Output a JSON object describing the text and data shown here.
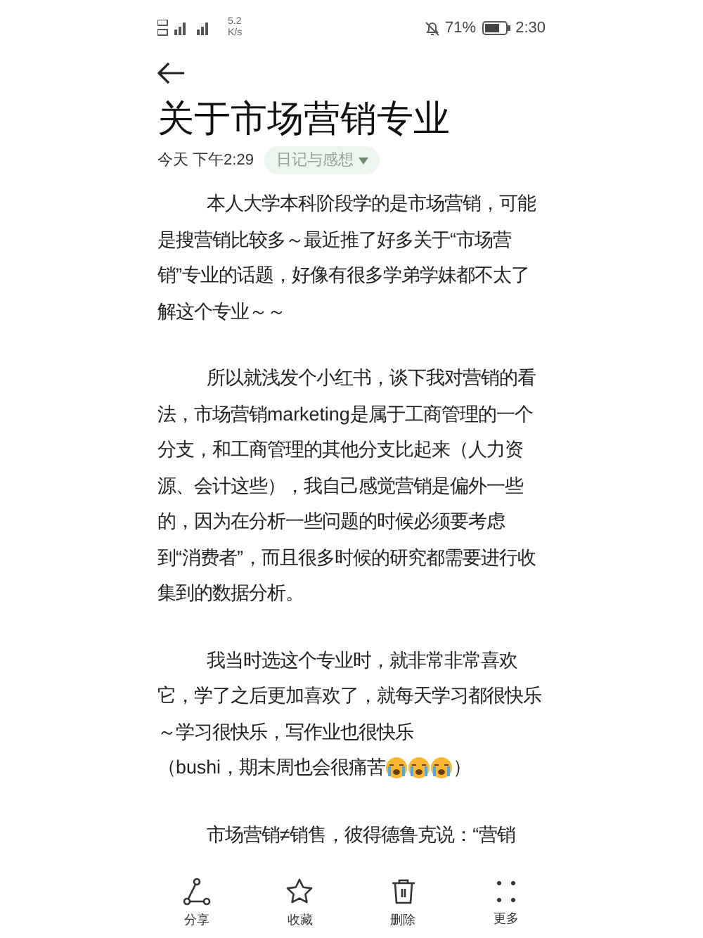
{
  "status_bar": {
    "network_speed": "5.2",
    "speed_unit": "K/s",
    "battery": "71%",
    "time": "2:30"
  },
  "title": "关于市场营销专业",
  "meta": {
    "date": "今天 下午2:29",
    "category": "日记与感想"
  },
  "paragraphs": [
    {
      "segments": [
        {
          "kind": "text",
          "text": "本人大学本科阶段学的是市场营销，可能是搜营销比较多～最近推了好多关于“市场营销”专业的话题，好像有很多学弟学妹都不太了解这个专业～～"
        }
      ]
    },
    {
      "segments": [
        {
          "kind": "text",
          "text": "所以就浅发个小红书，谈下我对营销的看法，市场营销marketing是属于工商管理的一个分支，和工商管理的其他分支比起来（人力资源、会计这些），我自己感觉营销是偏外一些的，因为在分析一些问题的时候必须要考虑到“消费者”，而且很多时候的研究都需要进行收集到的数据分析。"
        }
      ]
    },
    {
      "segments": [
        {
          "kind": "text",
          "text": "我当时选这个专业时，就非常非常喜欢它，学了之后更加喜欢了，就每天学习都很快乐～学习很快乐，写作业也很快乐"
        },
        {
          "kind": "text",
          "text": "（bushi，期末周也会很痛苦"
        },
        {
          "kind": "crying-emoji"
        },
        {
          "kind": "crying-emoji"
        },
        {
          "kind": "crying-emoji"
        },
        {
          "kind": "text",
          "text": "）"
        }
      ]
    },
    {
      "segments": [
        {
          "kind": "text",
          "text": "市场营销≠销售，彼得德鲁克说：“营销"
        }
      ]
    }
  ],
  "actions": [
    {
      "kind": "share",
      "label": "分享"
    },
    {
      "kind": "star",
      "label": "收藏"
    },
    {
      "kind": "trash",
      "label": "删除"
    },
    {
      "kind": "more",
      "label": "更多"
    }
  ]
}
